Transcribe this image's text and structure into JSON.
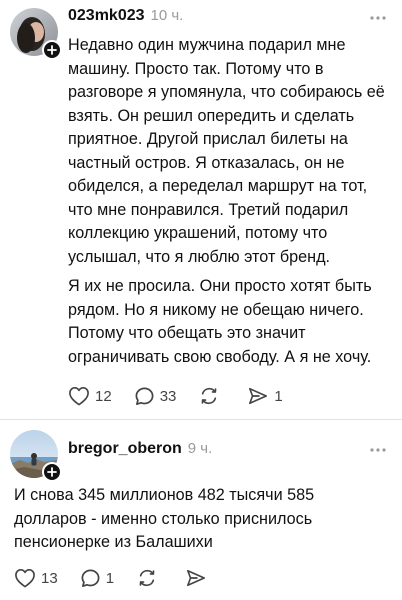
{
  "posts": [
    {
      "username": "023mk023",
      "time": "10 ч.",
      "paragraphs": [
        "Недавно один мужчина подарил мне машину. Просто так. Потому что в разговоре я упомянула, что собираюсь её взять. Он решил опередить и сделать приятное. Другой прислал билеты на частный остров. Я отказалась, он не обиделся, а переделал маршрут на тот, что мне понравился. Третий подарил коллекцию украшений, потому что услышал, что я люблю этот бренд.",
        "Я их не просила. Они просто хотят быть рядом. Но я никому не обещаю ничего. Потому что обещать это значит ограничивать свою свободу. А я не хочу."
      ],
      "likes": "12",
      "comments": "33",
      "reposts": "",
      "shares": "1"
    },
    {
      "username": "bregor_oberon",
      "time": "9 ч.",
      "paragraphs": [
        "И снова 345 миллионов 482 тысячи 585 долларов - именно столько приснилось пенсионерке из Балашихи"
      ],
      "likes": "13",
      "comments": "1",
      "reposts": "",
      "shares": ""
    }
  ],
  "icons": {
    "like": "heart-icon",
    "comment": "comment-bubble-icon",
    "repost": "repost-arrows-icon",
    "share": "send-arrow-icon",
    "more": "more-dots-icon",
    "follow": "plus-icon"
  },
  "colors": {
    "text": "#111111",
    "muted": "#9a9a9a",
    "icon": "#444444",
    "badge": "#111111"
  }
}
